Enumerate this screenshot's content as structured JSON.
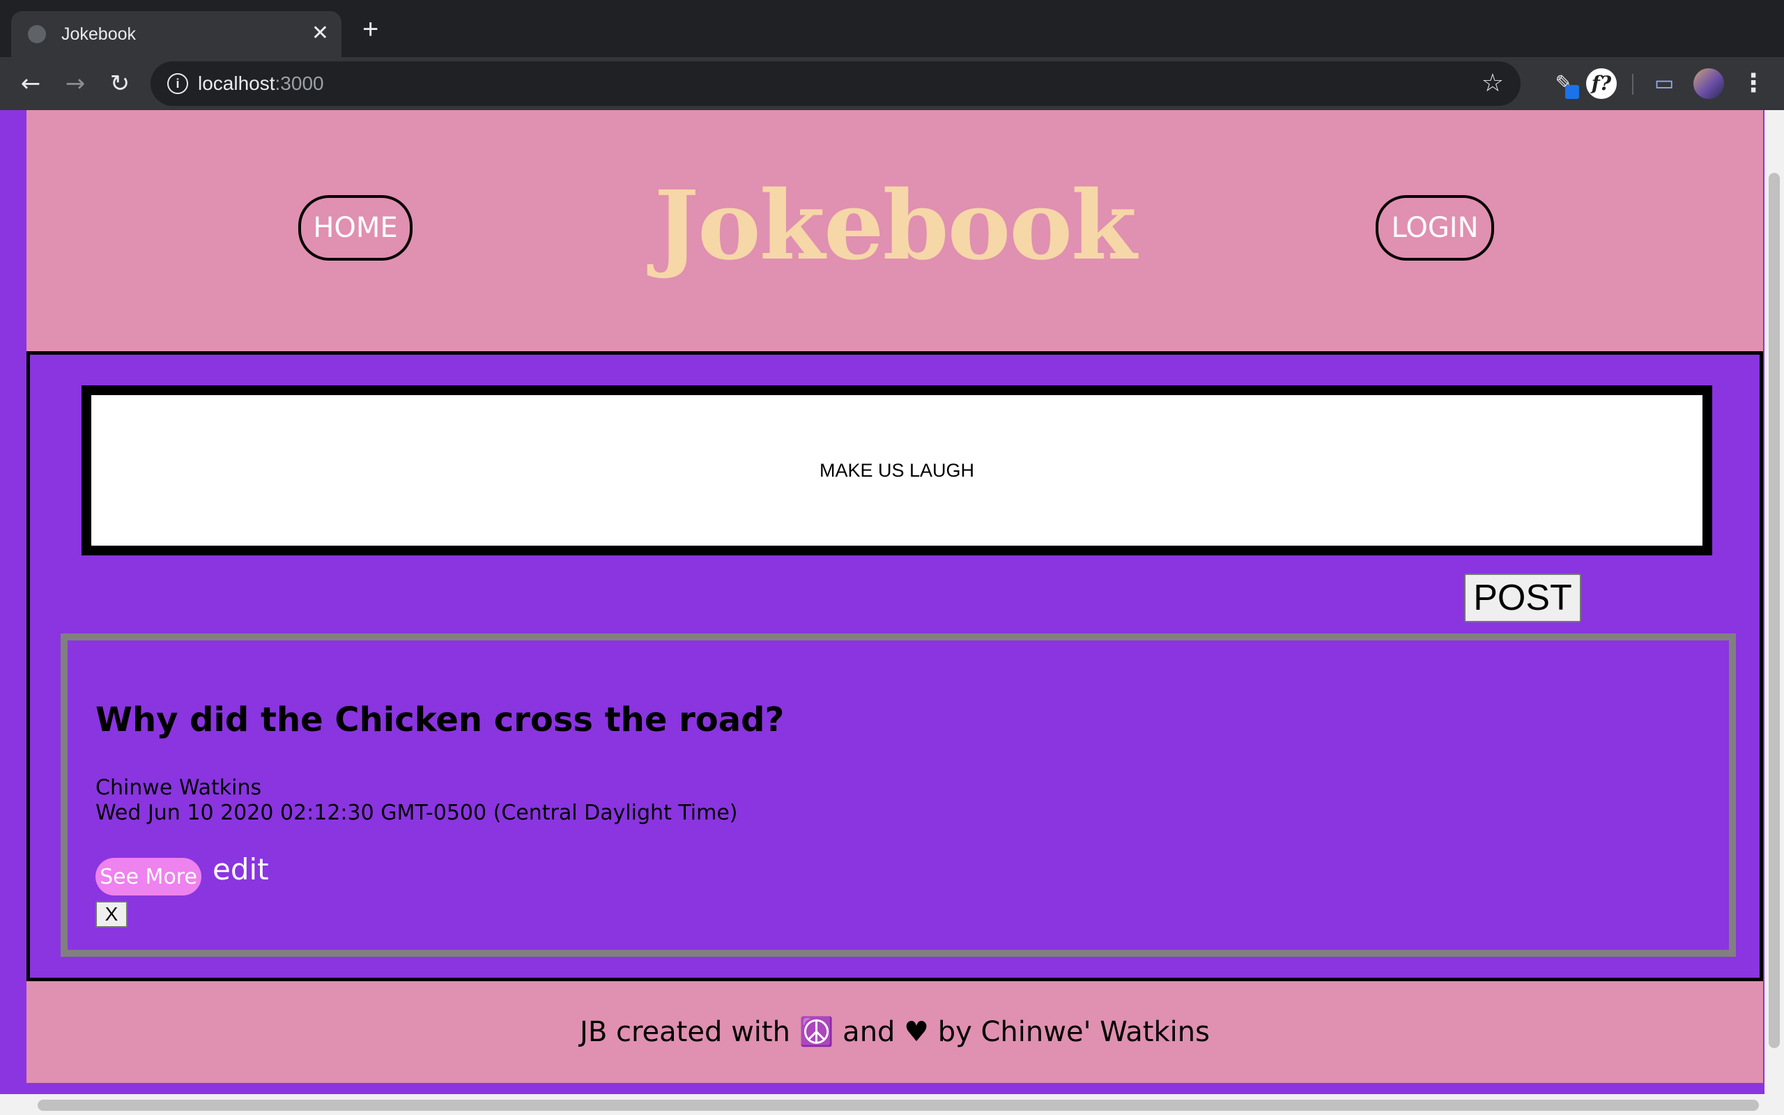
{
  "browser": {
    "tab_title": "Jokebook",
    "tab_close": "✕",
    "new_tab": "+",
    "url_host": "localhost",
    "url_port": ":3000",
    "back": "←",
    "forward": "→",
    "reload": "↻",
    "star": "☆",
    "info": "i",
    "menu": "⋮",
    "ext_label": "f?",
    "pen_glyph": "✎",
    "cast_glyph": "▭"
  },
  "header": {
    "home_label": "HOME",
    "logo": "Jokebook",
    "login_label": "LOGIN"
  },
  "compose": {
    "placeholder": "MAKE US LAUGH",
    "post_label": "POST"
  },
  "joke": {
    "title": "Why did the Chicken cross the road?",
    "author": "Chinwe Watkins",
    "date": "Wed Jun 10 2020 02:12:30 GMT-0500 (Central Daylight Time)",
    "see_more_label": "See More",
    "edit_label": "edit",
    "delete_label": "X"
  },
  "footer": {
    "text": "JB created with ☮️ and ♥ by Chinwe' Watkins"
  },
  "colors": {
    "page_bg": "#8a35e0",
    "header_bg": "#e090b0",
    "logo": "#f6d7a8",
    "see_more_bg": "#ee82ee"
  }
}
